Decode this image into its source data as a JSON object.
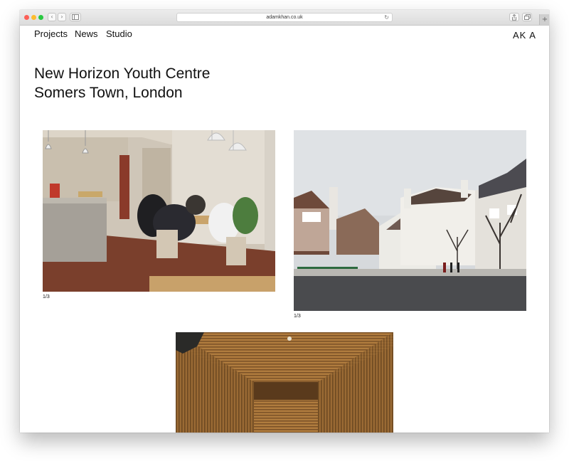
{
  "browser": {
    "url": "adamkhan.co.uk",
    "back_icon": "chevron-left",
    "forward_icon": "chevron-right",
    "sidebar_icon": "sidebar",
    "reload_icon": "reload",
    "share_icon": "share",
    "tabs_icon": "tabs",
    "new_tab_icon": "plus"
  },
  "nav": {
    "items": [
      {
        "label": "Projects"
      },
      {
        "label": "News"
      },
      {
        "label": "Studio"
      }
    ],
    "logo": "AK A"
  },
  "page": {
    "title_line1": "New Horizon Youth Centre",
    "title_line2": "Somers Town, London"
  },
  "gallery": {
    "images": [
      {
        "subject": "interior-study-room",
        "caption": "1/3"
      },
      {
        "subject": "street-exterior",
        "caption": "1/3"
      },
      {
        "subject": "timber-lined-room",
        "caption": ""
      }
    ]
  },
  "colors": {
    "chrome": "#dcdcdc",
    "text": "#111111",
    "close": "#fc5f57",
    "minimize": "#fdbc2e",
    "maximize": "#28c840"
  }
}
